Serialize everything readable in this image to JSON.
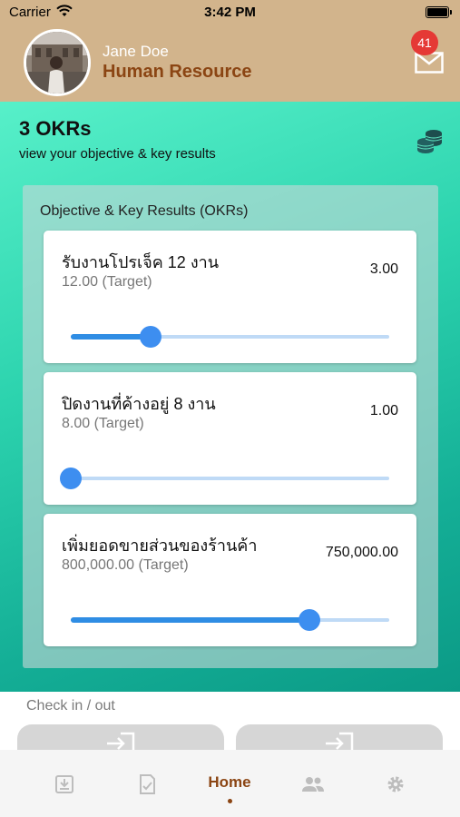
{
  "status_bar": {
    "carrier": "Carrier",
    "time": "3:42 PM"
  },
  "header": {
    "user_name": "Jane Doe",
    "role": "Human Resource",
    "mail_badge": "41"
  },
  "summary": {
    "count": "3 OKRs",
    "subtitle": "view your objective & key results"
  },
  "okr_panel": {
    "title": "Objective & Key Results (OKRs)",
    "items": [
      {
        "title": "รับงานโปรเจ็ค 12 งาน",
        "target": "12.00 (Target)",
        "value": "3.00",
        "progress": 0.25
      },
      {
        "title": "ปิดงานที่ค้างอยู่ 8 งาน",
        "target": "8.00 (Target)",
        "value": "1.00",
        "progress": 0.0
      },
      {
        "title": "เพิ่มยอดขายส่วนของร้านค้า",
        "target": "800,000.00 (Target)",
        "value": "750,000.00",
        "progress": 0.75
      }
    ]
  },
  "checkin": {
    "title": "Check in / out"
  },
  "tabbar": {
    "active_label": "Home"
  },
  "colors": {
    "header_bg": "#d2b48c",
    "accent": "#8b4513",
    "slider": "#2f8de4",
    "badge": "#e53935"
  },
  "icons": [
    "wifi-icon",
    "battery-icon",
    "mail-icon",
    "coins-icon",
    "login-icon",
    "download-tab-icon",
    "checklist-tab-icon",
    "people-tab-icon",
    "gear-tab-icon"
  ]
}
